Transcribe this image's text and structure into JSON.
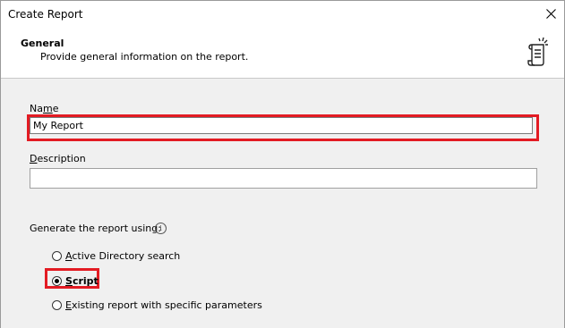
{
  "window": {
    "title": "Create Report",
    "close_icon": "close-icon"
  },
  "header": {
    "title": "General",
    "subtitle": "Provide general information on the report.",
    "icon": "scroll-report-icon"
  },
  "form": {
    "name_label_pre": "Na",
    "name_label_u": "m",
    "name_label_post": "e",
    "name_value": "My Report",
    "description_label_u": "D",
    "description_label_post": "escription",
    "description_value": "",
    "generate_label": "Generate the report using:",
    "info_icon": "info-icon",
    "options": [
      {
        "u": "A",
        "rest": "ctive Directory search",
        "checked": false
      },
      {
        "u": "S",
        "rest": "cript",
        "checked": true
      },
      {
        "u": "E",
        "rest": "xisting report with specific parameters",
        "checked": false
      }
    ]
  },
  "colors": {
    "highlight": "#e31b23",
    "header_bg": "#ffffff",
    "body_bg": "#f0f0f0"
  }
}
